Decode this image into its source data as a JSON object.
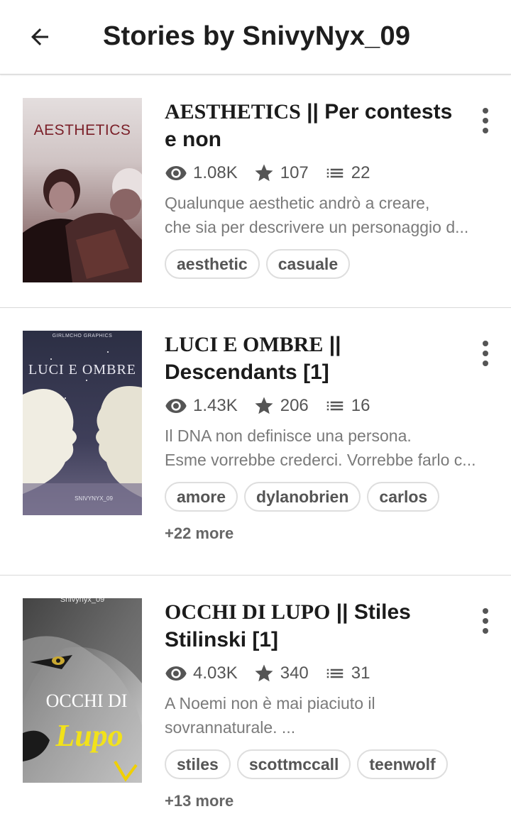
{
  "header": {
    "title": "Stories by SnivyNyx_09"
  },
  "stories": [
    {
      "title_serif": "AESTHETICS",
      "title_rest": " || Per contests e non",
      "reads": "1.08K",
      "votes": "107",
      "parts": "22",
      "desc_line1": "Qualunque aesthetic andrò a creare,",
      "desc_line2": "che sia per descrivere un personaggio d...",
      "tags": [
        "aesthetic",
        "casuale"
      ],
      "more": "",
      "cover_text": "AESTHETICS"
    },
    {
      "title_serif": "LUCI E OMBRE",
      "title_rest": " || Descendants [1]",
      "reads": "1.43K",
      "votes": "206",
      "parts": "16",
      "desc_line1": "Il DNA non definisce una persona.",
      "desc_line2": "Esme vorrebbe crederci. Vorrebbe farlo c...",
      "tags": [
        "amore",
        "dylanobrien",
        "carlos"
      ],
      "more": "+22 more",
      "cover_top": "GIRLMCHO GRAPHICS",
      "cover_text": "LUCI E OMBRE",
      "cover_bottom": "SNIVYNYX_09"
    },
    {
      "title_serif": "OCCHI DI LUPO",
      "title_rest": " || Stiles Stilinski [1]",
      "reads": "4.03K",
      "votes": "340",
      "parts": "31",
      "desc_line1": "A Noemi non è mai piaciuto il",
      "desc_line2": "sovrannaturale. ...",
      "tags": [
        "stiles",
        "scottmccall",
        "teenwolf"
      ],
      "more": "+13 more",
      "cover_top": "Snivynyx_09",
      "cover_text": "OCCHI DI",
      "cover_script": "Lupo"
    }
  ],
  "colors": {
    "text": "#1b1b1b",
    "meta": "#555555",
    "desc": "#7a7a7a",
    "tag_border": "#dedede"
  },
  "icons": {
    "back": "arrow-left-icon",
    "reads": "eye-icon",
    "votes": "star-icon",
    "parts": "list-icon",
    "menu": "kebab-icon"
  }
}
